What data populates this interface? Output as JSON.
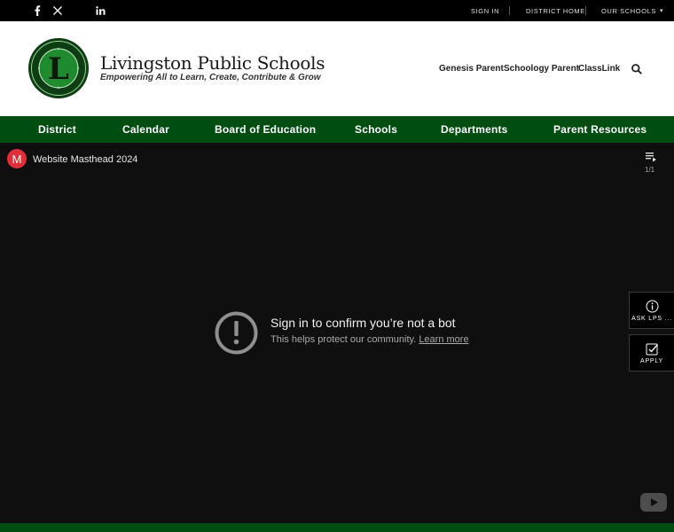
{
  "topbar": {
    "social": [
      "facebook-icon",
      "x-icon",
      "linkedin-icon"
    ],
    "links": {
      "sign_in": "SIGN IN",
      "district_home": "DISTRICT HOME",
      "our_schools": "OUR SCHOOLS"
    },
    "dropdown_glyph": "▾"
  },
  "header": {
    "title": "Livingston Public Schools",
    "tagline": "Empowering All to Learn, Create, Contribute & Grow",
    "logo_letter": "L",
    "quick_links": [
      "Genesis Parent",
      "Schoology Parent",
      "ClassLink"
    ]
  },
  "nav": {
    "items": [
      "District",
      "Calendar",
      "Board of Education",
      "Schools",
      "Departments",
      "Parent Resources"
    ]
  },
  "video": {
    "channel_initial": "M",
    "title": "Website Masthead 2024",
    "playlist_count": "1/1",
    "message_title": "Sign in to confirm you’re not a bot",
    "message_sub": "This helps protect our community.",
    "learn_more": "Learn more"
  },
  "side_tabs": {
    "ask": "ASK LPS ...",
    "apply": "APPLY"
  },
  "colors": {
    "brand_green": "#004d11",
    "logo_green": "#1f8a2e",
    "avatar_red": "#e02f3a"
  }
}
